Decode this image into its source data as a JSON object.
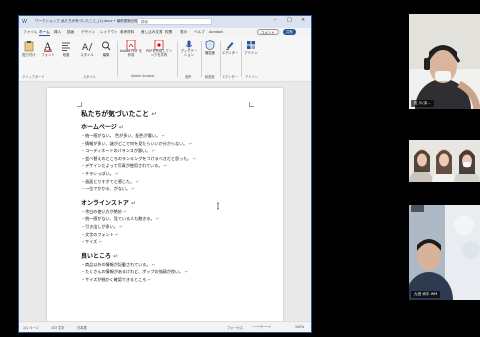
{
  "window": {
    "title": "ワークショップ_私たちが気づいたこと_(1).docx  •  最終更新日時: 13:00",
    "search": "検索",
    "comment_btn": "コメント",
    "share_btn": "共有"
  },
  "tabs": [
    "ファイル",
    "ホーム",
    "挿入",
    "描画",
    "デザイン",
    "レイアウト",
    "参考資料",
    "差し込み文書",
    "校閲",
    "表示",
    "ヘルプ",
    "Acrobat"
  ],
  "ribbon": {
    "buttons": [
      {
        "label": "貼り付け"
      },
      {
        "label": "フォント"
      },
      {
        "label": "段落"
      },
      {
        "label": "スタイル"
      },
      {
        "label": "編集"
      },
      {
        "label": "Adobe PDF を作成"
      },
      {
        "label": "PDFを作成してリンクを共有"
      },
      {
        "label": "ディクテーション"
      },
      {
        "label": "機密度"
      },
      {
        "label": "エディター"
      },
      {
        "label": "アドイン"
      }
    ],
    "groups": [
      "クリップボード",
      "スタイル",
      "Adobe Acrobat",
      "音声",
      "秘密度",
      "エディター",
      "アドイン"
    ]
  },
  "document": {
    "title": "私たちが気づいたこと",
    "sections": [
      {
        "heading": "ホームページ",
        "items": [
          "・統一感がない。 色が多い、配色が悪い。",
          "・情報が多い、謎がどこで何を見たらいいか分からない。",
          "・コーディネートのバランスが悪い。",
          "・並べ替えのところのランキングをつけるべきだと思った。",
          "・デザインだよって写真が使用されている。",
          "・チラシっぽい。",
          "・画面とりすぎてと感じた。",
          "・一位でかかる、がない。"
        ]
      },
      {
        "heading": "オンラインストア",
        "items": [
          "・余白の使い方が絶妙",
          "・統一感がない、見ている人も飽きる。",
          "・引き出しが多い。",
          "・文字のフォント",
          "・サイズ"
        ]
      },
      {
        "heading": "良いところ",
        "items": [
          "・商品以外の情報が記載されている。",
          "・たくさんの情報があるけれど、ボップの強弱が良い。",
          "・サイズが細かく確認できるところ"
        ]
      }
    ]
  },
  "statusbar": {
    "page": "1/1 ページ",
    "words": "433 文字",
    "lang": "日本語",
    "focus": "フォーカス",
    "zoom": "100%"
  },
  "participants": [
    {
      "name": "佐 川(あ..."
    },
    {
      "name": ""
    },
    {
      "name": "九田 尚平",
      "badge": "WM"
    }
  ],
  "colors": {
    "accent": "#2b579a",
    "bg": "#000000"
  }
}
